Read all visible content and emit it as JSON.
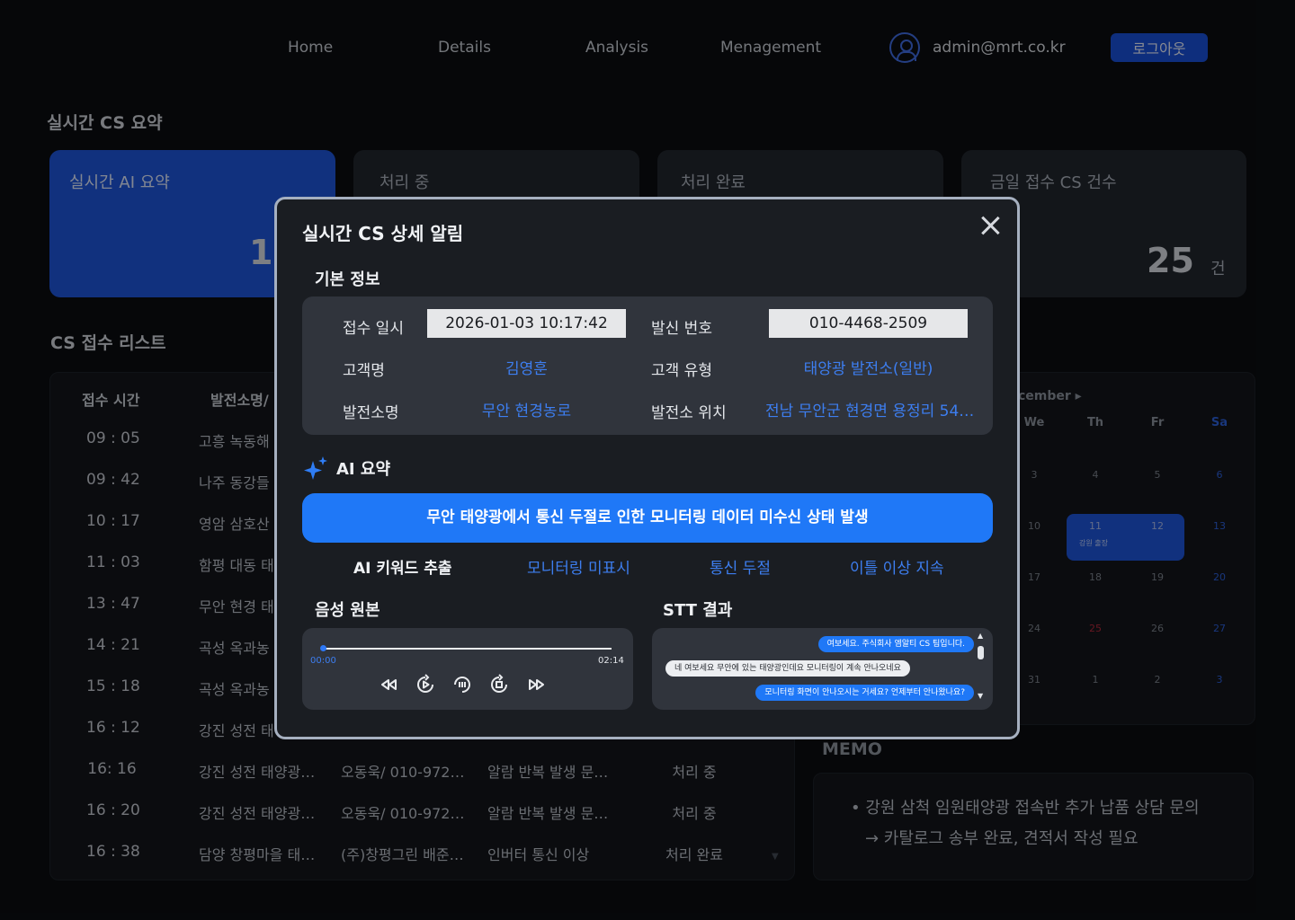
{
  "nav": {
    "items": [
      "Home",
      "Details",
      "Analysis",
      "Menagement"
    ],
    "user_email": "admin@mrt.co.kr",
    "logout_label": "로그아웃"
  },
  "summary": {
    "title": "실시간 CS 요약",
    "cards": [
      {
        "label": "실시간 AI 요약",
        "value": "1",
        "unit": ""
      },
      {
        "label": "처리 중",
        "value": "",
        "unit": ""
      },
      {
        "label": "처리 완료",
        "value": "",
        "unit": ""
      },
      {
        "label": "금일 접수 CS 건수",
        "value": "25",
        "unit": "건"
      }
    ]
  },
  "cs_list": {
    "title": "CS 접수 리스트",
    "headers": [
      "접수 시간",
      "발전소명/"
    ],
    "rows": [
      {
        "time": "09 : 05",
        "plant": "고흥 녹동해",
        "customer": "",
        "issue": "",
        "status": ""
      },
      {
        "time": "09 : 42",
        "plant": "나주 동강들",
        "customer": "",
        "issue": "",
        "status": ""
      },
      {
        "time": "10 : 17",
        "plant": "영암 삼호산",
        "customer": "",
        "issue": "",
        "status": ""
      },
      {
        "time": "11 : 03",
        "plant": "함평 대동 태",
        "customer": "",
        "issue": "",
        "status": ""
      },
      {
        "time": "13 : 47",
        "plant": "무안 현경 태",
        "customer": "",
        "issue": "",
        "status": ""
      },
      {
        "time": "14 : 21",
        "plant": "곡성 옥과농",
        "customer": "",
        "issue": "",
        "status": ""
      },
      {
        "time": "15 : 18",
        "plant": "곡성 옥과농",
        "customer": "",
        "issue": "",
        "status": ""
      },
      {
        "time": "16 : 12",
        "plant": "강진 성전 태",
        "customer": "",
        "issue": "",
        "status": ""
      },
      {
        "time": "16: 16",
        "plant": "강진 성전 태양광…",
        "customer": "오동욱/ 010-972…",
        "issue": "알람 반복 발생 문…",
        "status": "처리 중"
      },
      {
        "time": "16 : 20",
        "plant": "강진 성전 태양광…",
        "customer": "오동욱/ 010-972…",
        "issue": "알람 반복 발생 문…",
        "status": "처리 중"
      },
      {
        "time": "16 : 38",
        "plant": "담양 창평마을 태…",
        "customer": "(주)창평그린 배준…",
        "issue": "인버터 통신 이상",
        "status": "처리 완료"
      }
    ]
  },
  "calendar": {
    "month_label": "cember ▸",
    "weekdays": [
      "We",
      "Th",
      "Fr",
      "Sa"
    ],
    "weeks": [
      [
        "3",
        "4",
        "5",
        "6"
      ],
      [
        "10",
        "11",
        "12",
        "13"
      ],
      [
        "17",
        "18",
        "19",
        "20"
      ],
      [
        "24",
        "25",
        "26",
        "27"
      ],
      [
        "31",
        "1",
        "2",
        "3"
      ]
    ],
    "event_label": "강원 출장",
    "colors": {
      "saturday": "#2c5fd8",
      "holiday": "#b0283a",
      "event": "#1e55d9"
    }
  },
  "memo": {
    "title": "MEMO",
    "lines": [
      "•  강원 삼척 임원태양광 접속반 추가 납품 상담 문의",
      "→ 카탈로그 송부 완료, 견적서 작성 필요"
    ]
  },
  "modal": {
    "title": "실시간 CS 상세 알림",
    "basic_title": "기본 정보",
    "fields": {
      "received_label": "접수 일시",
      "received_value": "2026-01-03 10:17:42",
      "caller_label": "발신 번호",
      "caller_value": "010-4468-2509",
      "customer_label": "고객명",
      "customer_value": "김영훈",
      "type_label": "고객 유형",
      "type_value": "태양광 발전소(일반)",
      "plant_label": "발전소명",
      "plant_value": "무안 현경농로",
      "location_label": "발전소 위치",
      "location_value": "전남 무안군 현경면 용정리 54…"
    },
    "ai_title": "AI 요약",
    "ai_summary": "무안 태양광에서 통신 두절로 인한 모니터링 데이터 미수신 상태 발생",
    "keywords_label": "AI 키워드 추출",
    "keywords": [
      "모니터링 미표시",
      "통신 두절",
      "이틀 이상 지속"
    ],
    "audio_title": "음성 원본",
    "audio": {
      "current": "00:00",
      "total": "02:14",
      "progress": 0
    },
    "stt_title": "STT 결과",
    "stt_messages": [
      {
        "side": "out",
        "text": "여보세요. 주식회사 엠알티 CS 팀입니다."
      },
      {
        "side": "in",
        "text": "네 여보세요 무안에 있는 태양광인데요 모니터링이 계속 안나오네요"
      },
      {
        "side": "out",
        "text": "모니터링 화면이 안나오시는 거세요? 언제부터 안나왔나요?"
      }
    ],
    "accent_color": "#1f78f7"
  }
}
